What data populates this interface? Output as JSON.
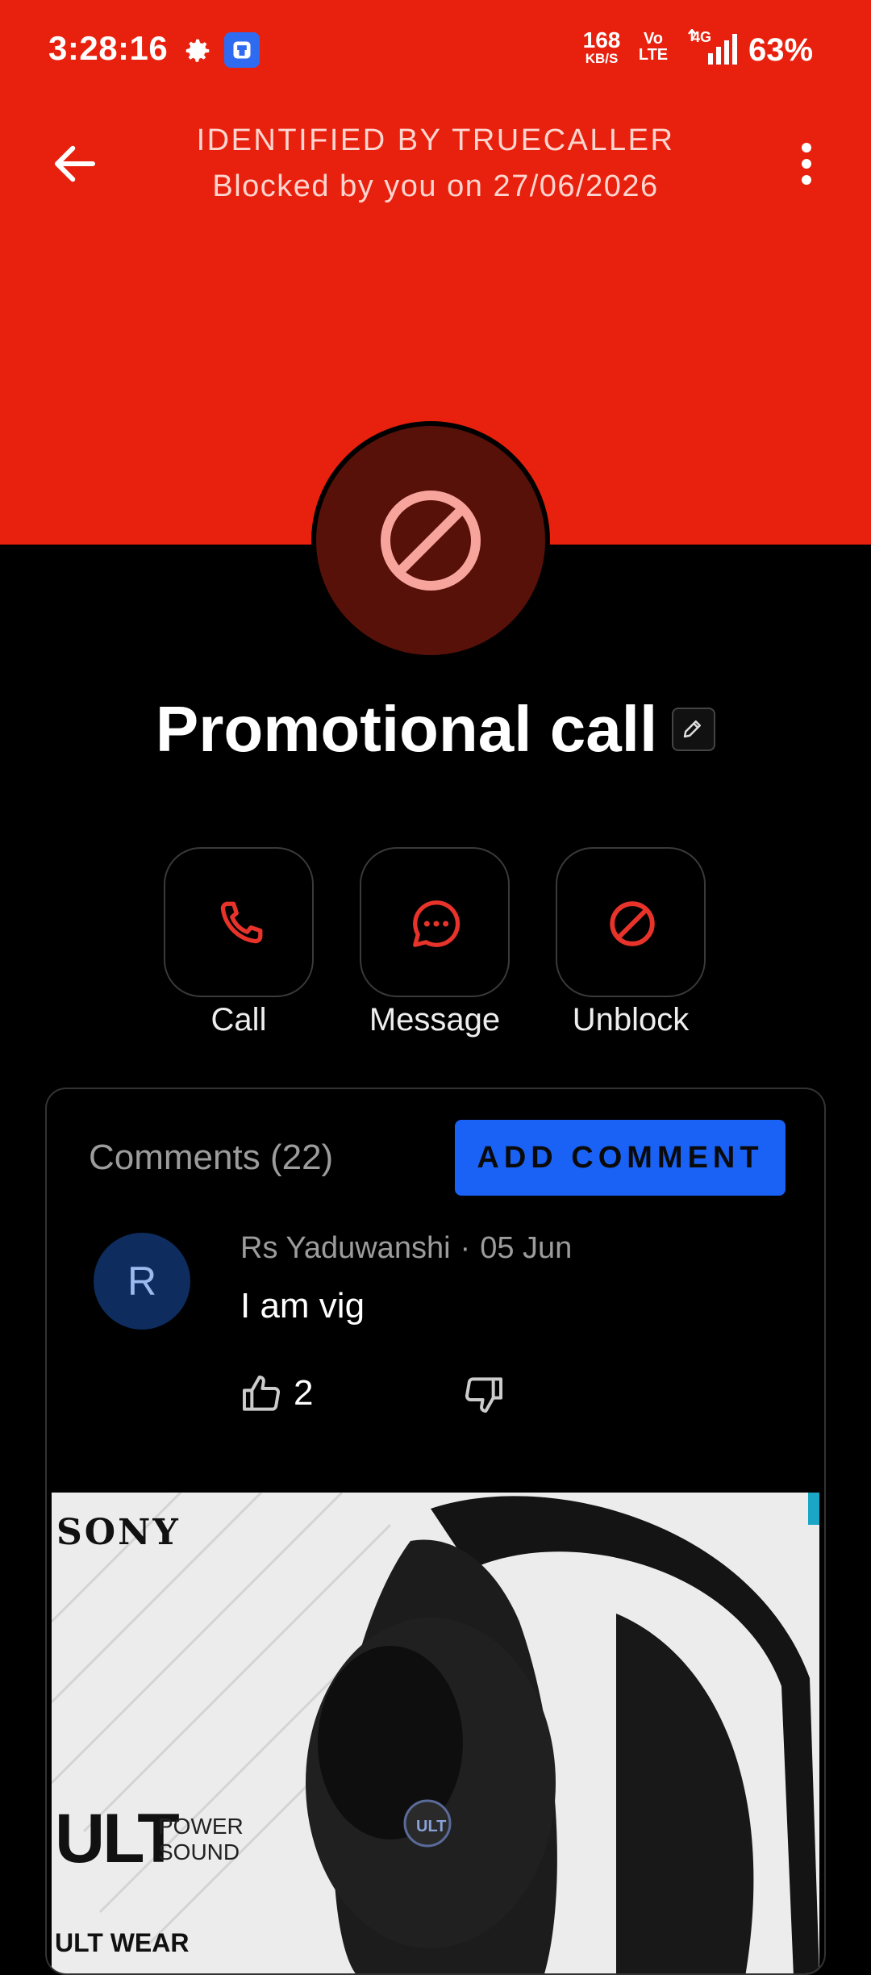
{
  "status_bar": {
    "time": "3:28:16",
    "speed_value": "168",
    "speed_unit": "KB/S",
    "volte_top": "Vo",
    "volte_bottom": "LTE",
    "network": "4G",
    "battery": "63%",
    "icons": [
      "gear-icon",
      "app-notification-icon",
      "signal-icon"
    ]
  },
  "header": {
    "title": "IDENTIFIED BY TRUECALLER",
    "subtitle": "Blocked by you on 27/06/2026",
    "color": "#E8200E"
  },
  "contact": {
    "name": "Promotional call"
  },
  "actions": [
    {
      "label": "Call",
      "icon": "phone-icon"
    },
    {
      "label": "Message",
      "icon": "message-icon"
    },
    {
      "label": "Unblock",
      "icon": "block-icon"
    }
  ],
  "comments": {
    "title": "Comments (22)",
    "add_label": "ADD COMMENT",
    "items": [
      {
        "initial": "R",
        "author": "Rs Yaduwanshi",
        "separator": "·",
        "date": "05 Jun",
        "text": "I am vig",
        "likes": "2"
      }
    ]
  },
  "ad": {
    "brand": "SONY",
    "product": "ULT",
    "tagline_1": "POWER",
    "tagline_2": "SOUND",
    "series": "ULT WEAR"
  },
  "colors": {
    "accent": "#E8200E",
    "button_blue": "#1A62F5",
    "icon_red": "#E8332A"
  }
}
